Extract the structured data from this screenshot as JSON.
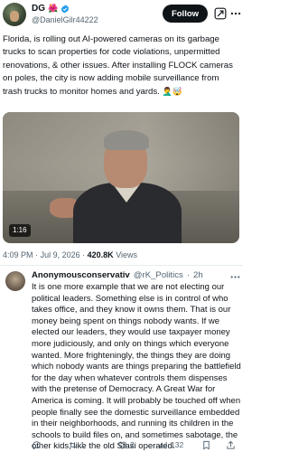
{
  "post": {
    "author_name": "DG",
    "author_emoji": "🌺",
    "author_handle": "@DanielGilr44222",
    "follow_label": "Follow",
    "text": "Florida, is rolling out AI-powered cameras on its garbage trucks to scan properties for code violations, unpermitted renovations, & other issues. After installing FLOCK cameras on poles, the city is now adding mobile surveillance from trash trucks to monitor homes and yards.",
    "text_emojis": "🤦‍♂️🤯",
    "video_duration": "1:16",
    "time": "4:09 PM",
    "separator": "·",
    "date": "Jul 9, 2026",
    "views_count": "420.8K",
    "views_label": "Views"
  },
  "reply": {
    "author_name": "Anonymousconservativ",
    "author_handle": "@rK_Politics",
    "age": "2h",
    "separator": "·",
    "text": "It is one more example that we are not electing our political leaders. Something else is in control of who takes office, and they know it owns them. That is our money being spent on things nobody wants. If we elected our leaders, they would use taxpayer money more judiciously, and  only on things which everyone wanted. More frighteningly, the things they are doing which nobody wants are things preparing the battlefield for the day when whatever controls them dispenses with the pretense of Democracy. A Great War for America is coming. It will probably be  touched off when people finally see the domestic surveillance embedded in their neighborhoods, and running its children in the schools to build files on, and sometimes sabotage, the other kids, like the old Stasi operated.",
    "actions": {
      "replies": "",
      "reposts": "1",
      "likes": "2",
      "views": "132"
    }
  },
  "colors": {
    "text": "#0f1419",
    "secondary": "#536471",
    "verified": "#1d9bf0",
    "divider": "#e6ecf0"
  },
  "icons": [
    "verified-badge-icon",
    "grok-icon",
    "more-icon",
    "reply-icon",
    "repost-icon",
    "like-icon",
    "views-icon",
    "bookmark-icon",
    "share-icon"
  ]
}
